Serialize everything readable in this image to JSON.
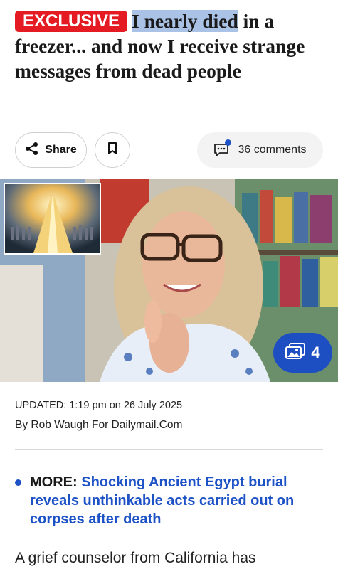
{
  "article": {
    "badge": "EXCLUSIVE",
    "headline_highlighted": "I nearly died",
    "headline_rest": " in a freezer... and now I receive strange messages from dead people"
  },
  "actions": {
    "share_label": "Share",
    "comments_label": "36 comments"
  },
  "hero": {
    "gallery_count": "4"
  },
  "meta": {
    "updated": "UPDATED: 1:19 pm on 26 July 2025",
    "byline": "By Rob Waugh For Dailymail.Com"
  },
  "more": {
    "prefix": "MORE:",
    "link": "Shocking Ancient Egypt burial reveals unthinkable acts carried out on corpses after death"
  },
  "body": {
    "first_line": "A grief counselor from California has"
  },
  "colors": {
    "badge_red": "#e41b23",
    "link_blue": "#1d52c7",
    "gallery_blue": "#1d4fc2",
    "highlight": "#a9c2e6"
  }
}
